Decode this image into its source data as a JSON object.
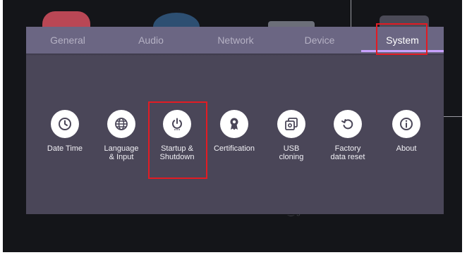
{
  "tabs": [
    {
      "label": "General",
      "active": false
    },
    {
      "label": "Audio",
      "active": false
    },
    {
      "label": "Network",
      "active": false
    },
    {
      "label": "Device",
      "active": false
    },
    {
      "label": "System",
      "active": true
    }
  ],
  "items": [
    {
      "label": "Date Time",
      "icon": "clock-icon"
    },
    {
      "label": "Language\n& Input",
      "icon": "globe-icon"
    },
    {
      "label": "Startup &\nShutdown",
      "icon": "power-icon"
    },
    {
      "label": "Certification",
      "icon": "award-ribbon-icon"
    },
    {
      "label": "USB\ncloning",
      "icon": "stacked-copy-icon"
    },
    {
      "label": "Factory\ndata reset",
      "icon": "reset-arrow-icon"
    },
    {
      "label": "About",
      "icon": "info-icon"
    }
  ],
  "colors": {
    "tab_bar": "#6b6683",
    "panel": "#4a4658",
    "active_underline": "#c9a2ff",
    "highlight_box": "#e31b23",
    "icon_glyph": "#4a4658"
  }
}
